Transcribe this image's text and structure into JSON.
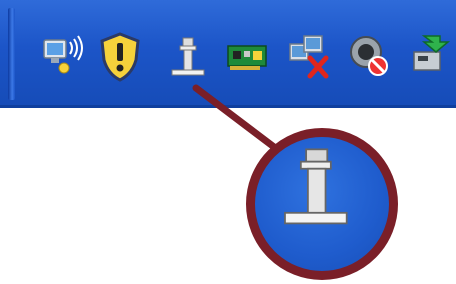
{
  "taskbar": {
    "icons": [
      {
        "name": "wireless-network-icon"
      },
      {
        "name": "security-shield-icon"
      },
      {
        "name": "usb-device-icon"
      },
      {
        "name": "network-card-icon"
      },
      {
        "name": "network-disconnected-icon"
      },
      {
        "name": "volume-muted-icon"
      },
      {
        "name": "safely-remove-hardware-icon"
      }
    ]
  },
  "callout": {
    "icon": "usb-device-icon",
    "colors": {
      "ring": "#7a1f28",
      "line": "#7a1f28",
      "tray": "#1c55c8"
    }
  }
}
